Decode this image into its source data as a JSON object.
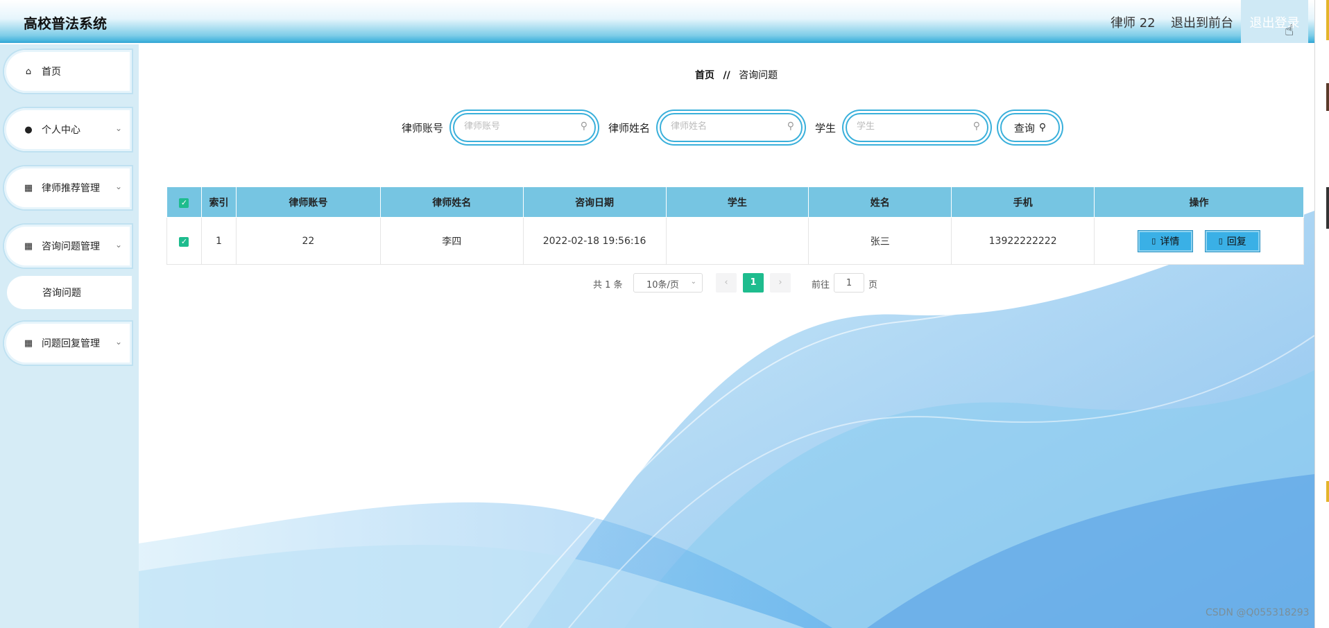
{
  "header": {
    "title": "高校普法系统",
    "user": "律师 22",
    "front_link": "退出到前台",
    "logout": "退出登录"
  },
  "sidebar": {
    "items": [
      {
        "label": "首页",
        "icon": "home-icon"
      },
      {
        "label": "个人中心",
        "icon": "user-icon"
      },
      {
        "label": "律师推荐管理",
        "icon": "grid-icon"
      },
      {
        "label": "咨询问题管理",
        "icon": "grid-icon"
      },
      {
        "label": "咨询问题",
        "icon": ""
      },
      {
        "label": "问题回复管理",
        "icon": "grid-icon"
      }
    ]
  },
  "breadcrumb": {
    "home": "首页",
    "separator": "//",
    "current": "咨询问题"
  },
  "search": {
    "fields": [
      {
        "label": "律师账号",
        "placeholder": "律师账号"
      },
      {
        "label": "律师姓名",
        "placeholder": "律师姓名"
      },
      {
        "label": "学生",
        "placeholder": "学生"
      }
    ],
    "button": "查询"
  },
  "table": {
    "headers": [
      "索引",
      "律师账号",
      "律师姓名",
      "咨询日期",
      "学生",
      "姓名",
      "手机",
      "操作"
    ],
    "rows": [
      {
        "index": "1",
        "lawyer_account": "22",
        "lawyer_name": "李四",
        "date": "2022-02-18 19:56:16",
        "student": "",
        "name": "张三",
        "phone": "13922222222"
      }
    ],
    "actions": {
      "detail": "详情",
      "reply": "回复"
    }
  },
  "pagination": {
    "total": "共 1 条",
    "page_size": "10条/页",
    "current_page": "1",
    "goto_label": "前往",
    "goto_value": "1",
    "page_unit": "页"
  },
  "watermark": "CSDN @Q055318293",
  "colors": {
    "accent": "#3ab0db",
    "header_blue": "#76c5e2",
    "sidebar_bg": "#d6ecf6",
    "green": "#1ebc8e",
    "action_button": "#3ab0e6"
  }
}
